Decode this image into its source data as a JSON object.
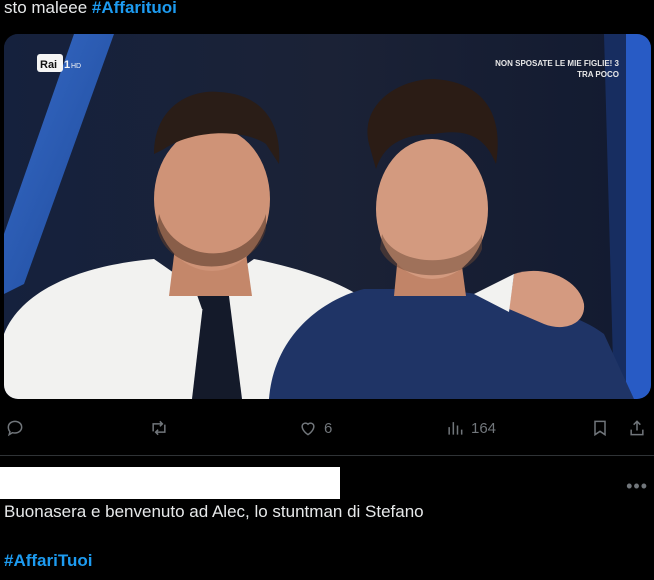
{
  "tweet": {
    "text_prefix": "sto maleee ",
    "hashtag": "#Affarituoi"
  },
  "media": {
    "logo_rai": "Rai",
    "logo_channel": "1",
    "logo_hd": "HD",
    "overlay_line1": "NON SPOSATE LE MIE FIGLIE! 3",
    "overlay_line2": "TRA POCO"
  },
  "actions": {
    "reply_icon": "reply-icon",
    "retweet_icon": "retweet-icon",
    "like_icon": "heart-icon",
    "like_count": "6",
    "views_icon": "views-icon",
    "views_count": "164",
    "bookmark_icon": "bookmark-icon",
    "share_icon": "share-icon"
  },
  "reply": {
    "more_label": "•••",
    "text": "Buonasera e benvenuto ad Alec, lo stuntman di Stefano",
    "hashtag": "#AffariTuoi"
  },
  "colors": {
    "background": "#000000",
    "text": "#e7e9ea",
    "accent": "#1d9bf0",
    "muted": "#71767b"
  }
}
